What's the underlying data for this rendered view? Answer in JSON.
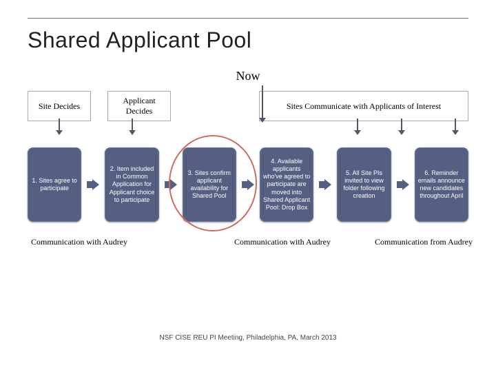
{
  "title": "Shared Applicant Pool",
  "now": "Now",
  "headers": {
    "site": "Site Decides",
    "applicant": "Applicant Decides",
    "comm": "Sites Communicate with Applicants of Interest"
  },
  "steps": [
    "1. Sites agree to participate",
    "2. Item included in Common Application for Applicant choice to participate",
    "3. Sites confirm applicant availability for Shared Pool",
    "4. Available applicants who've agreed to participate are moved into Shared Applicant Pool: Drop Box",
    "5. All Site PIs invited to view folder following creation",
    "6. Reminder emails announce new candidates throughout April"
  ],
  "labels": {
    "a": "Communication with Audrey",
    "b": "Communication with Audrey",
    "c": "Communication from Audrey"
  },
  "footer": "NSF CISE REU PI Meeting, Philadelphia, PA, March 2013"
}
